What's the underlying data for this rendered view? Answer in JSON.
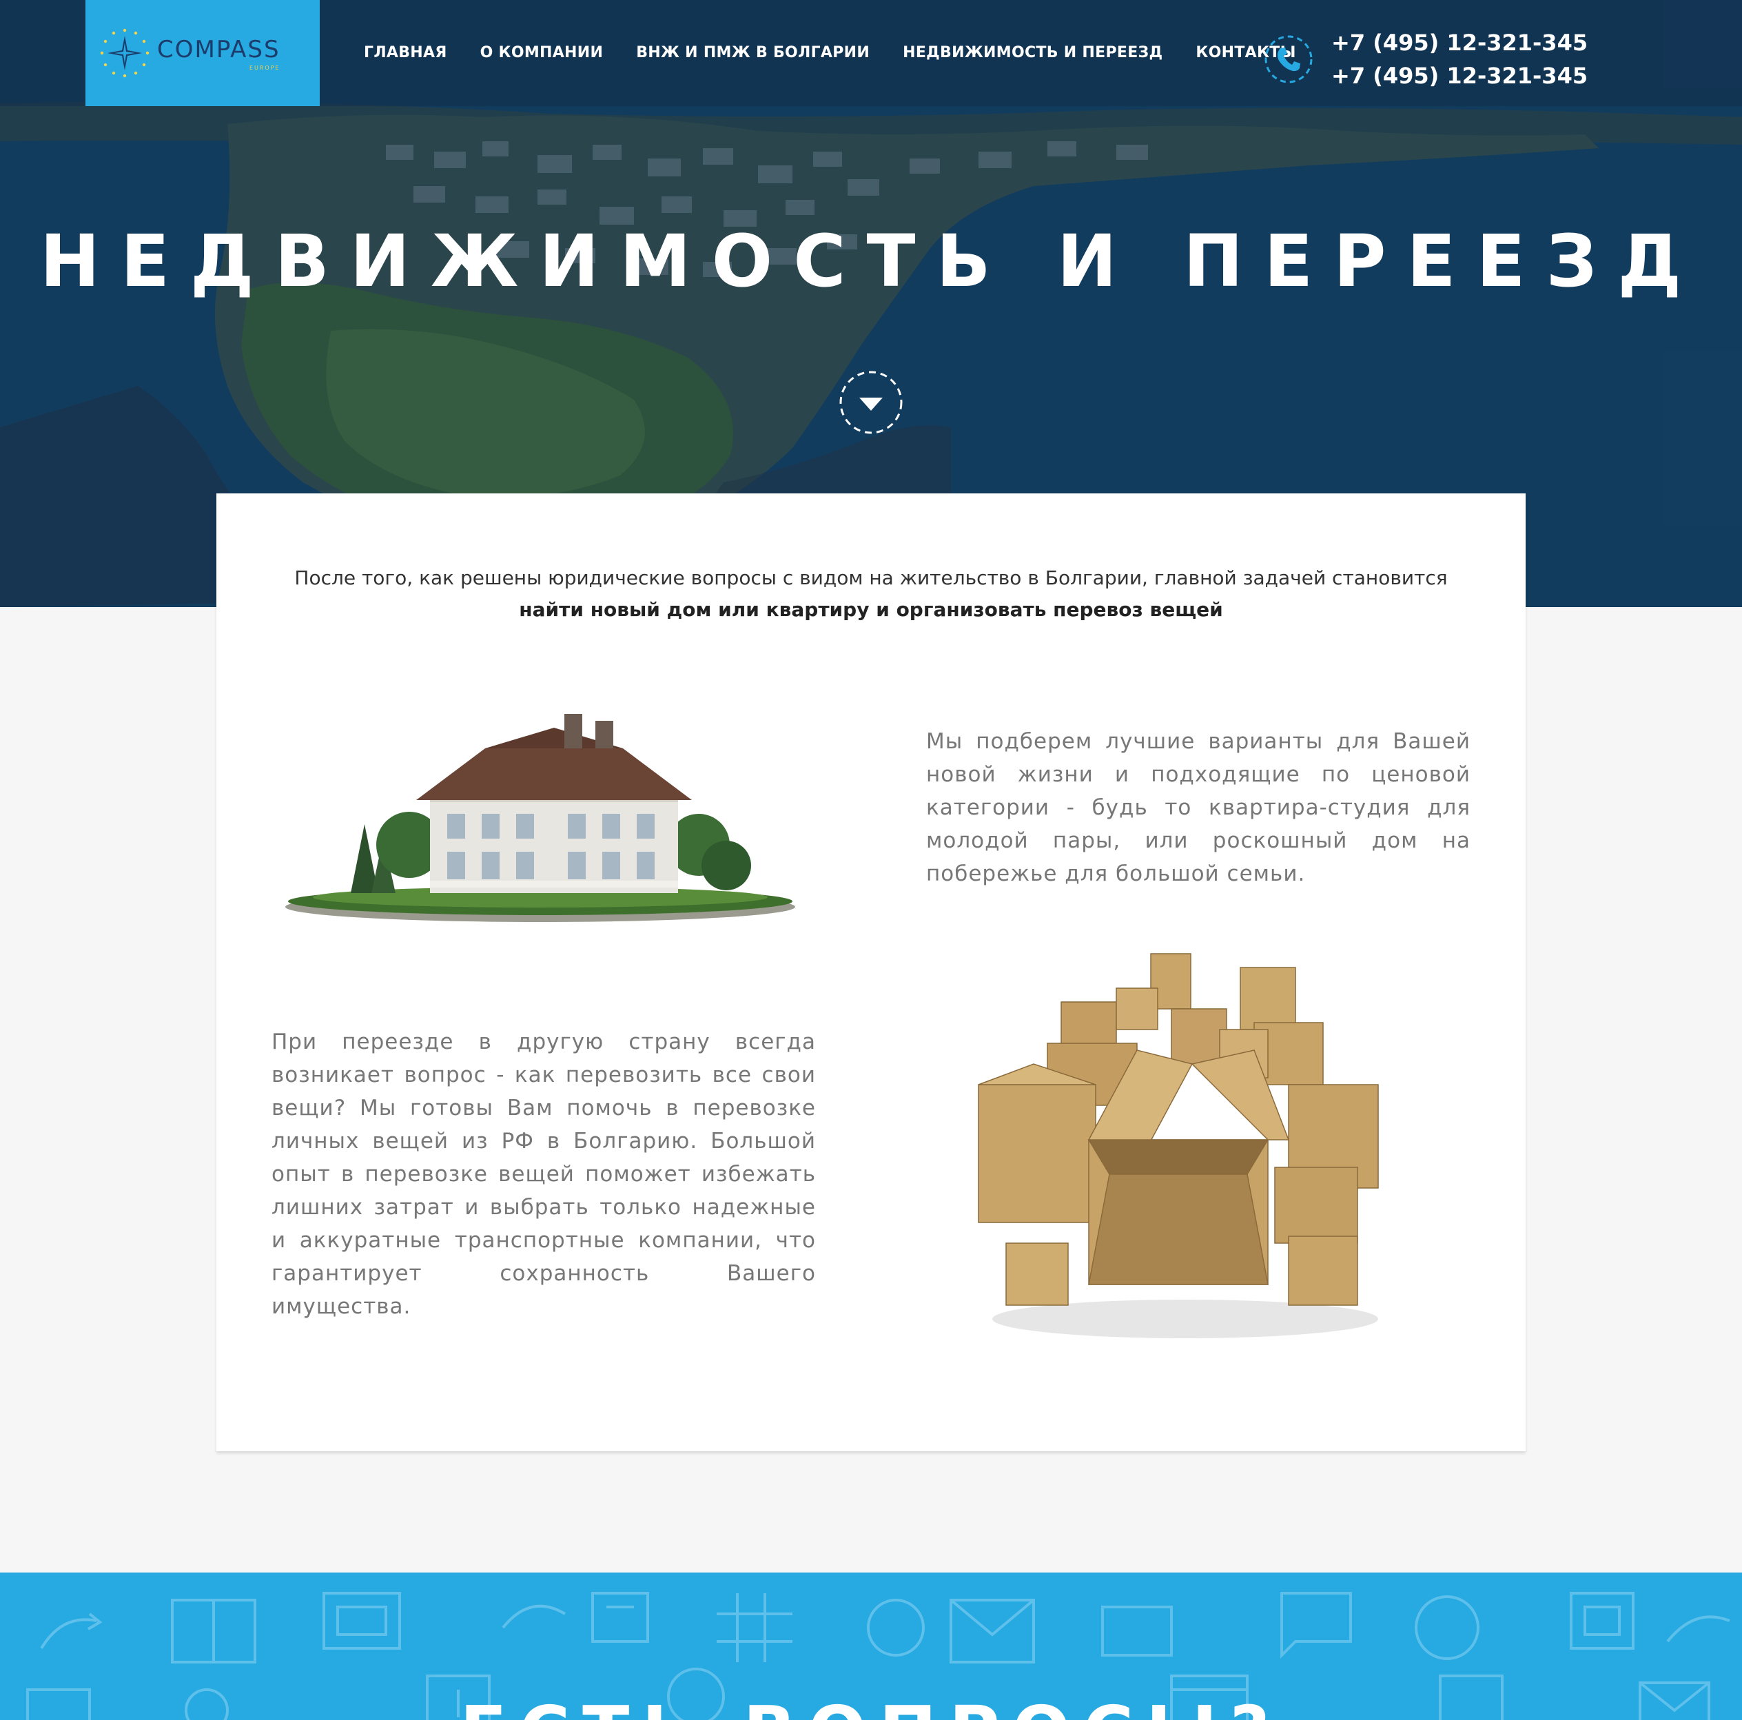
{
  "header": {
    "logo_title": "COMPASS",
    "logo_sub": "EUROPE",
    "nav": [
      {
        "label": "ГЛАВНАЯ"
      },
      {
        "label": "О КОМПАНИИ"
      },
      {
        "label": "ВНЖ И ПМЖ В БОЛГАРИИ"
      },
      {
        "label": "НЕДВИЖИМОСТЬ И ПЕРЕЕЗД"
      },
      {
        "label": "КОНТАКТЫ"
      }
    ],
    "phones": [
      "+7 (495) 12-321-345",
      "+7 (495) 12-321-345"
    ],
    "phone_icon": "phone-icon"
  },
  "hero": {
    "title": "НЕДВИЖИМОСТЬ И ПЕРЕЕЗД",
    "scroll_icon": "chevron-down-icon"
  },
  "content": {
    "intro_line1": "После того, как решены юридические вопросы с видом на жительство в Болгарии, главной задачей становится",
    "intro_line2": "найти новый дом или квартиру и организовать перевоз вещей",
    "block1_text": "Мы подберем лучшие варианты для Вашей новой жизни и подходящие по ценовой категории - будь то квартира-студия для молодой пары, или роскошный дом на побережье для большой семьи.",
    "block2_text": "При переезде в другую страну всегда возникает вопрос - как перевозить все свои вещи? Мы готовы Вам помочь в перевозке личных вещей из РФ в Болгарию. Большой опыт в перевозке вещей поможет избежать лишних затрат и выбрать только надежные и аккуратные транспортные компании, что гарантирует сохранность Вашего имущества."
  },
  "questions": {
    "title": "ЕСТЬ ВОПРОСЫ?"
  },
  "colors": {
    "accent": "#27a9e1",
    "logo_text": "#1c3d6b",
    "body_text": "#777777",
    "page_bg": "#f6f6f6"
  }
}
